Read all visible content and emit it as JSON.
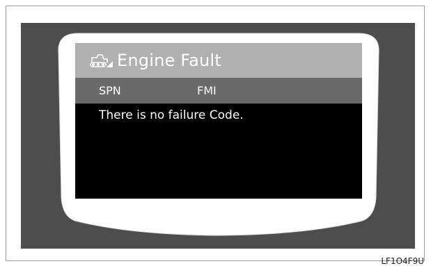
{
  "screen": {
    "title": "Engine Fault",
    "title_icon": "bulldozer-warning-icon",
    "columns": {
      "spn": "SPN",
      "fmi": "FMI"
    },
    "message": "There is no failure Code."
  },
  "figure_code": "LF1O4F9U",
  "colors": {
    "title_bar": "#b0b0b0",
    "header_bar": "#6a6a6a",
    "screen_bg": "#000000",
    "bezel": "#ffffff",
    "surround": "#4d4d4d"
  }
}
